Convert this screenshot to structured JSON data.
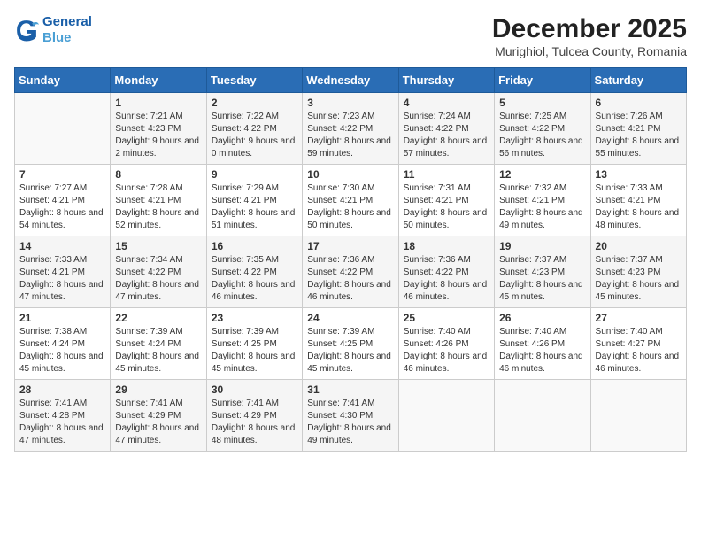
{
  "header": {
    "logo_line1": "General",
    "logo_line2": "Blue",
    "month_year": "December 2025",
    "location": "Murighiol, Tulcea County, Romania"
  },
  "weekdays": [
    "Sunday",
    "Monday",
    "Tuesday",
    "Wednesday",
    "Thursday",
    "Friday",
    "Saturday"
  ],
  "weeks": [
    [
      {
        "day": "",
        "sunrise": "",
        "sunset": "",
        "daylight": ""
      },
      {
        "day": "1",
        "sunrise": "Sunrise: 7:21 AM",
        "sunset": "Sunset: 4:23 PM",
        "daylight": "Daylight: 9 hours and 2 minutes."
      },
      {
        "day": "2",
        "sunrise": "Sunrise: 7:22 AM",
        "sunset": "Sunset: 4:22 PM",
        "daylight": "Daylight: 9 hours and 0 minutes."
      },
      {
        "day": "3",
        "sunrise": "Sunrise: 7:23 AM",
        "sunset": "Sunset: 4:22 PM",
        "daylight": "Daylight: 8 hours and 59 minutes."
      },
      {
        "day": "4",
        "sunrise": "Sunrise: 7:24 AM",
        "sunset": "Sunset: 4:22 PM",
        "daylight": "Daylight: 8 hours and 57 minutes."
      },
      {
        "day": "5",
        "sunrise": "Sunrise: 7:25 AM",
        "sunset": "Sunset: 4:22 PM",
        "daylight": "Daylight: 8 hours and 56 minutes."
      },
      {
        "day": "6",
        "sunrise": "Sunrise: 7:26 AM",
        "sunset": "Sunset: 4:21 PM",
        "daylight": "Daylight: 8 hours and 55 minutes."
      }
    ],
    [
      {
        "day": "7",
        "sunrise": "Sunrise: 7:27 AM",
        "sunset": "Sunset: 4:21 PM",
        "daylight": "Daylight: 8 hours and 54 minutes."
      },
      {
        "day": "8",
        "sunrise": "Sunrise: 7:28 AM",
        "sunset": "Sunset: 4:21 PM",
        "daylight": "Daylight: 8 hours and 52 minutes."
      },
      {
        "day": "9",
        "sunrise": "Sunrise: 7:29 AM",
        "sunset": "Sunset: 4:21 PM",
        "daylight": "Daylight: 8 hours and 51 minutes."
      },
      {
        "day": "10",
        "sunrise": "Sunrise: 7:30 AM",
        "sunset": "Sunset: 4:21 PM",
        "daylight": "Daylight: 8 hours and 50 minutes."
      },
      {
        "day": "11",
        "sunrise": "Sunrise: 7:31 AM",
        "sunset": "Sunset: 4:21 PM",
        "daylight": "Daylight: 8 hours and 50 minutes."
      },
      {
        "day": "12",
        "sunrise": "Sunrise: 7:32 AM",
        "sunset": "Sunset: 4:21 PM",
        "daylight": "Daylight: 8 hours and 49 minutes."
      },
      {
        "day": "13",
        "sunrise": "Sunrise: 7:33 AM",
        "sunset": "Sunset: 4:21 PM",
        "daylight": "Daylight: 8 hours and 48 minutes."
      }
    ],
    [
      {
        "day": "14",
        "sunrise": "Sunrise: 7:33 AM",
        "sunset": "Sunset: 4:21 PM",
        "daylight": "Daylight: 8 hours and 47 minutes."
      },
      {
        "day": "15",
        "sunrise": "Sunrise: 7:34 AM",
        "sunset": "Sunset: 4:22 PM",
        "daylight": "Daylight: 8 hours and 47 minutes."
      },
      {
        "day": "16",
        "sunrise": "Sunrise: 7:35 AM",
        "sunset": "Sunset: 4:22 PM",
        "daylight": "Daylight: 8 hours and 46 minutes."
      },
      {
        "day": "17",
        "sunrise": "Sunrise: 7:36 AM",
        "sunset": "Sunset: 4:22 PM",
        "daylight": "Daylight: 8 hours and 46 minutes."
      },
      {
        "day": "18",
        "sunrise": "Sunrise: 7:36 AM",
        "sunset": "Sunset: 4:22 PM",
        "daylight": "Daylight: 8 hours and 46 minutes."
      },
      {
        "day": "19",
        "sunrise": "Sunrise: 7:37 AM",
        "sunset": "Sunset: 4:23 PM",
        "daylight": "Daylight: 8 hours and 45 minutes."
      },
      {
        "day": "20",
        "sunrise": "Sunrise: 7:37 AM",
        "sunset": "Sunset: 4:23 PM",
        "daylight": "Daylight: 8 hours and 45 minutes."
      }
    ],
    [
      {
        "day": "21",
        "sunrise": "Sunrise: 7:38 AM",
        "sunset": "Sunset: 4:24 PM",
        "daylight": "Daylight: 8 hours and 45 minutes."
      },
      {
        "day": "22",
        "sunrise": "Sunrise: 7:39 AM",
        "sunset": "Sunset: 4:24 PM",
        "daylight": "Daylight: 8 hours and 45 minutes."
      },
      {
        "day": "23",
        "sunrise": "Sunrise: 7:39 AM",
        "sunset": "Sunset: 4:25 PM",
        "daylight": "Daylight: 8 hours and 45 minutes."
      },
      {
        "day": "24",
        "sunrise": "Sunrise: 7:39 AM",
        "sunset": "Sunset: 4:25 PM",
        "daylight": "Daylight: 8 hours and 45 minutes."
      },
      {
        "day": "25",
        "sunrise": "Sunrise: 7:40 AM",
        "sunset": "Sunset: 4:26 PM",
        "daylight": "Daylight: 8 hours and 46 minutes."
      },
      {
        "day": "26",
        "sunrise": "Sunrise: 7:40 AM",
        "sunset": "Sunset: 4:26 PM",
        "daylight": "Daylight: 8 hours and 46 minutes."
      },
      {
        "day": "27",
        "sunrise": "Sunrise: 7:40 AM",
        "sunset": "Sunset: 4:27 PM",
        "daylight": "Daylight: 8 hours and 46 minutes."
      }
    ],
    [
      {
        "day": "28",
        "sunrise": "Sunrise: 7:41 AM",
        "sunset": "Sunset: 4:28 PM",
        "daylight": "Daylight: 8 hours and 47 minutes."
      },
      {
        "day": "29",
        "sunrise": "Sunrise: 7:41 AM",
        "sunset": "Sunset: 4:29 PM",
        "daylight": "Daylight: 8 hours and 47 minutes."
      },
      {
        "day": "30",
        "sunrise": "Sunrise: 7:41 AM",
        "sunset": "Sunset: 4:29 PM",
        "daylight": "Daylight: 8 hours and 48 minutes."
      },
      {
        "day": "31",
        "sunrise": "Sunrise: 7:41 AM",
        "sunset": "Sunset: 4:30 PM",
        "daylight": "Daylight: 8 hours and 49 minutes."
      },
      {
        "day": "",
        "sunrise": "",
        "sunset": "",
        "daylight": ""
      },
      {
        "day": "",
        "sunrise": "",
        "sunset": "",
        "daylight": ""
      },
      {
        "day": "",
        "sunrise": "",
        "sunset": "",
        "daylight": ""
      }
    ]
  ]
}
